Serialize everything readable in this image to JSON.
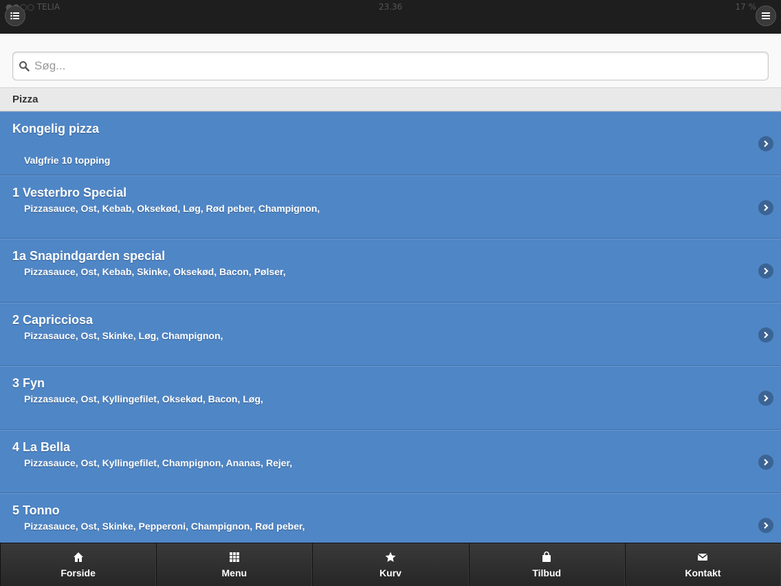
{
  "status": {
    "carrier": "●●○○ TELIA",
    "time": "23.36",
    "battery": "17 %"
  },
  "search": {
    "placeholder": "Søg..."
  },
  "section": {
    "title": "Pizza"
  },
  "items": [
    {
      "title": "Kongelig pizza",
      "desc": "Valgfrie 10 topping"
    },
    {
      "title": "1 Vesterbro Special",
      "desc": "Pizzasauce, Ost, Kebab, Oksekød, Løg, Rød peber, Champignon,"
    },
    {
      "title": "1a Snapindgarden special",
      "desc": "Pizzasauce, Ost, Kebab, Skinke, Oksekød, Bacon, Pølser,"
    },
    {
      "title": "2 Capricciosa",
      "desc": "Pizzasauce, Ost, Skinke, Løg, Champignon,"
    },
    {
      "title": "3 Fyn",
      "desc": "Pizzasauce, Ost, Kyllingefilet, Oksekød, Bacon, Løg,"
    },
    {
      "title": "4 La Bella",
      "desc": "Pizzasauce, Ost, Kyllingefilet, Champignon, Ananas, Rejer,"
    },
    {
      "title": "5 Tonno",
      "desc": "Pizzasauce, Ost, Skinke, Pepperoni, Champignon, Rød peber,"
    }
  ],
  "nav": [
    {
      "label": "Forside",
      "icon": "home-icon"
    },
    {
      "label": "Menu",
      "icon": "grid-icon"
    },
    {
      "label": "Kurv",
      "icon": "star-icon"
    },
    {
      "label": "Tilbud",
      "icon": "bag-icon"
    },
    {
      "label": "Kontakt",
      "icon": "mail-icon"
    }
  ],
  "colors": {
    "list_bg": "#4f86c6",
    "header_bg": "#1e1e1e",
    "nav_bg": "#2a2a2a"
  }
}
